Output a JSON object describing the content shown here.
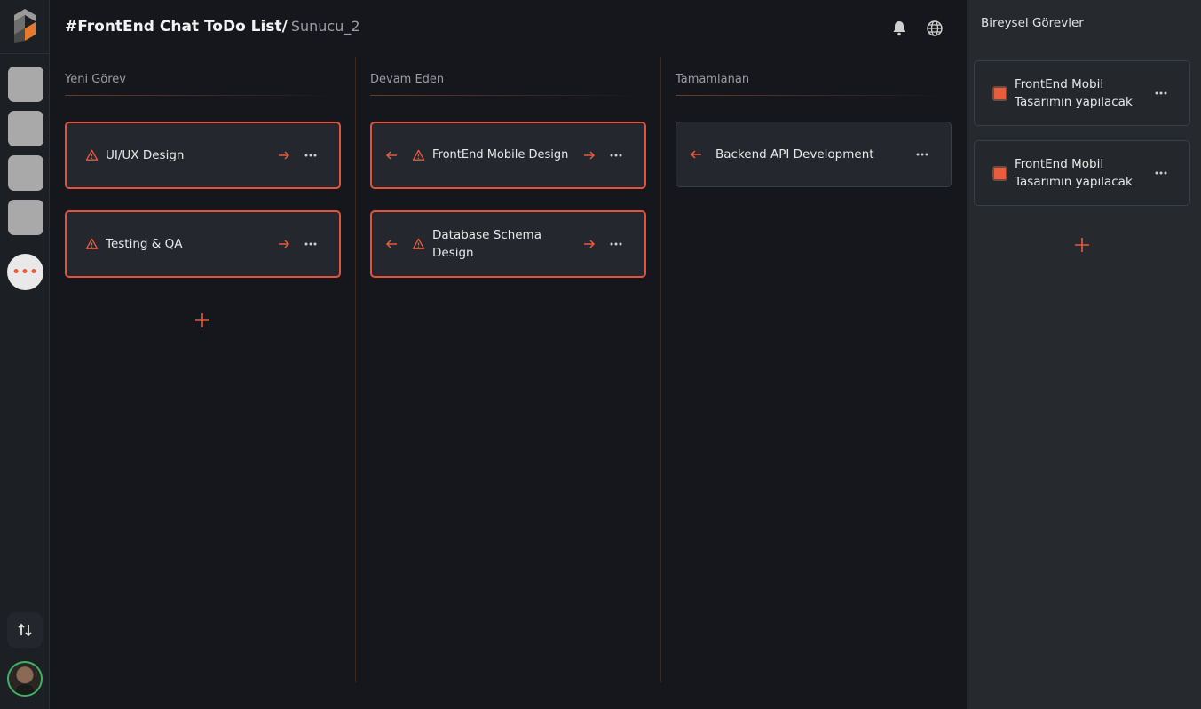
{
  "header": {
    "title": "#FrontEnd Chat ToDo List/",
    "subtitle": "Sunucu_2",
    "icons": [
      "bell-icon",
      "globe-icon"
    ]
  },
  "rail": {
    "servers": [
      "server-1",
      "server-2",
      "server-3",
      "server-4"
    ],
    "more_label": "•••",
    "icons": [
      "app-logo-icon",
      "sort-arrows-icon"
    ]
  },
  "columns": [
    {
      "title": "Yeni Görev",
      "cards": [
        {
          "label": "UI/UX Design"
        },
        {
          "label": "Testing & QA"
        }
      ]
    },
    {
      "title": "Devam Eden",
      "cards": [
        {
          "label": "FrontEnd Mobile Design"
        },
        {
          "label": "Database Schema Design"
        }
      ]
    },
    {
      "title": "Tamamlanan",
      "cards": [
        {
          "label": "Backend API Development"
        }
      ]
    }
  ],
  "panel": {
    "title": "Bireysel Görevler",
    "tasks": [
      {
        "label": "FrontEnd Mobil Tasarımın yapılacak"
      },
      {
        "label": "FrontEnd Mobil Tasarımın yapılacak"
      }
    ]
  },
  "colors": {
    "accent": "#e85a3a",
    "background": "#15171c",
    "card": "#24272d",
    "panel": "#262a2f",
    "avatar_ring": "#3fb163"
  }
}
